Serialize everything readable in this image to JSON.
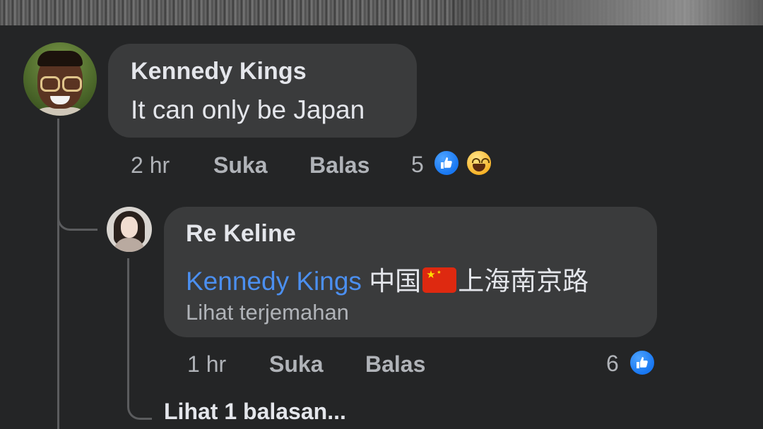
{
  "comments": [
    {
      "author": "Kennedy Kings",
      "text": "It can only be Japan",
      "time": "2 hr",
      "like_label": "Suka",
      "reply_label": "Balas",
      "reaction_count": "5",
      "reactions": [
        "like-icon",
        "haha-icon"
      ]
    }
  ],
  "reply": {
    "author": "Re Keline",
    "mention": "Kennedy Kings",
    "text_before_flag": "中国",
    "flag": "china-flag-emoji",
    "text_after_flag": "上海南京路",
    "see_translation": "Lihat terjemahan",
    "time": "1 hr",
    "like_label": "Suka",
    "reply_label": "Balas",
    "reaction_count": "6",
    "reactions": [
      "like-icon"
    ]
  },
  "view_more_replies": "Lihat 1 balasan...",
  "colors": {
    "background": "#242526",
    "bubble": "#3a3b3c",
    "primary_text": "#e4e6eb",
    "secondary_text": "#b0b3b8",
    "mention": "#4b8ff0",
    "like_blue": "#1877f2"
  }
}
